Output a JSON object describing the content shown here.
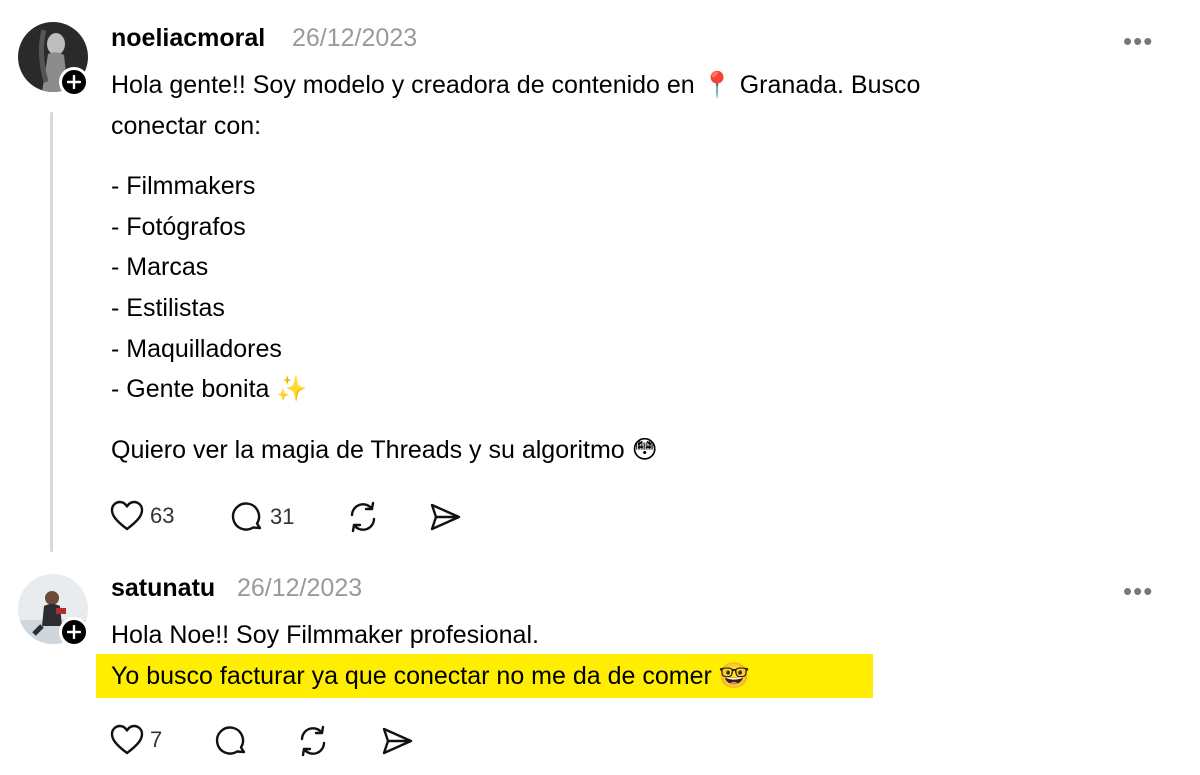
{
  "posts": [
    {
      "username": "noeliacmoral",
      "date": "26/12/2023",
      "more_label": "•••",
      "text_lines": [
        "Hola gente!! Soy modelo y creadora de contenido en 📍 Granada. Busco",
        "conectar con:",
        "- Filmmakers",
        "- Fotógrafos",
        "- Marcas",
        "- Estilistas",
        "- Maquilladores",
        "- Gente bonita ✨",
        "Quiero ver la magia de Threads y su algoritmo 😳"
      ],
      "likes": "63",
      "replies": "31",
      "icons": [
        "heart-icon",
        "comment-icon",
        "repost-icon",
        "share-icon"
      ]
    },
    {
      "username": "satunatu",
      "date": "26/12/2023",
      "more_label": "•••",
      "text_lines": [
        "Hola Noe!! Soy Filmmaker profesional.",
        "Yo busco facturar ya que conectar no me da de comer 🤓"
      ],
      "highlight_color": "#ffee00",
      "likes": "7",
      "icons": [
        "heart-icon",
        "comment-icon",
        "repost-icon",
        "share-icon"
      ]
    }
  ]
}
